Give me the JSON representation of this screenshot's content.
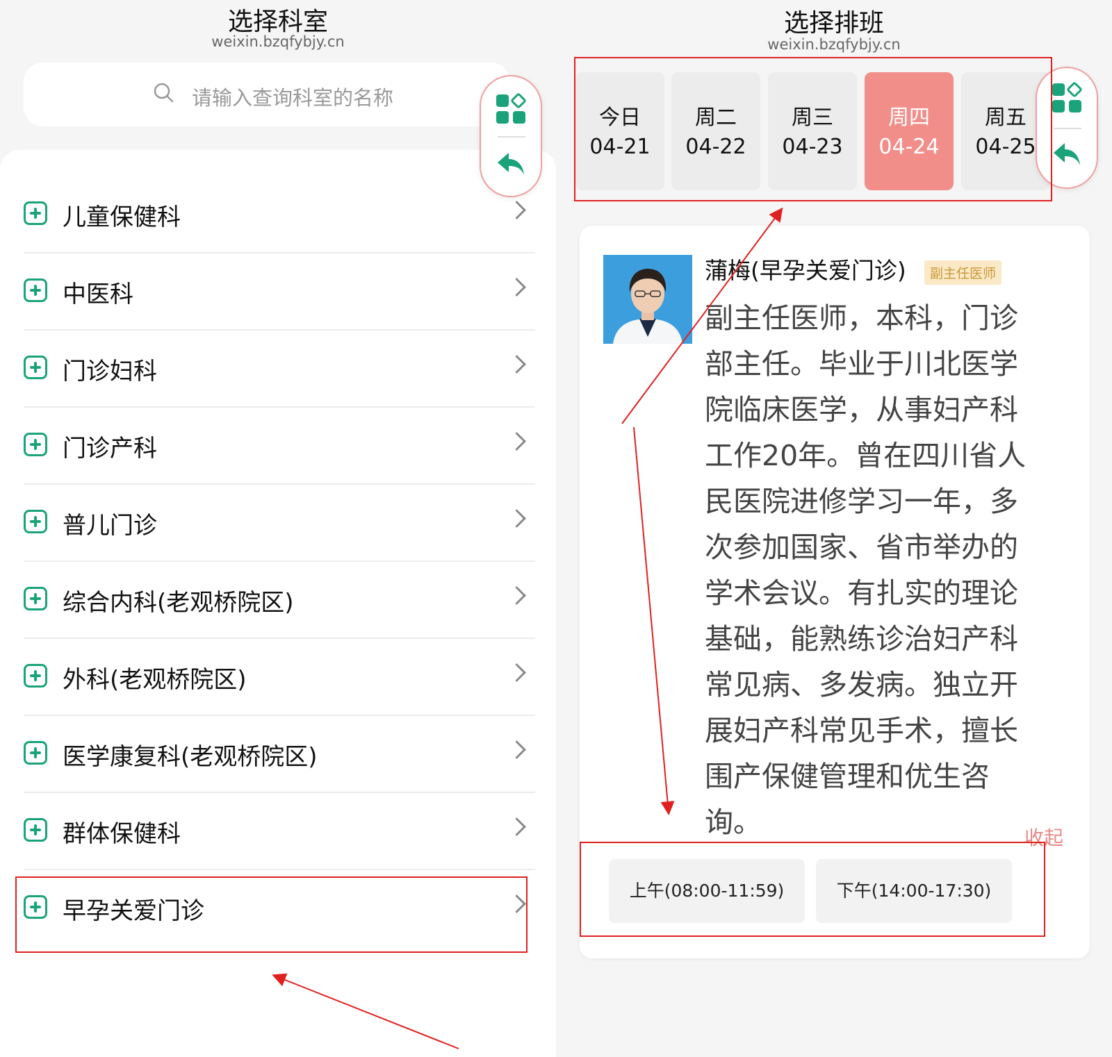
{
  "left": {
    "title": "选择科室",
    "url": "weixin.bzqfybjy.cn",
    "search_placeholder": "请输入查询科室的名称",
    "departments": [
      "儿童保健科",
      "中医科",
      "门诊妇科",
      "门诊产科",
      "普儿门诊",
      "综合内科(老观桥院区)",
      "外科(老观桥院区)",
      "医学康复科(老观桥院区)",
      "群体保健科",
      "早孕关爱门诊"
    ]
  },
  "right": {
    "title": "选择排班",
    "url": "weixin.bzqfybjy.cn",
    "days": [
      {
        "weekday": "今日",
        "date": "04-21",
        "selected": false
      },
      {
        "weekday": "周二",
        "date": "04-22",
        "selected": false
      },
      {
        "weekday": "周三",
        "date": "04-23",
        "selected": false
      },
      {
        "weekday": "周四",
        "date": "04-24",
        "selected": true
      },
      {
        "weekday": "周五",
        "date": "04-25",
        "selected": false
      }
    ],
    "doctor": {
      "name": "蒲梅(早孕关爱门诊)",
      "title_badge": "副主任医师",
      "bio": "副主任医师，本科，门诊部主任。毕业于川北医学院临床医学，从事妇产科工作20年。曾在四川省人民医院进修学习一年，多次参加国家、省市举办的学术会议。有扎实的理论基础，能熟练诊治妇产科常见病、多发病。独立开展妇产科常见手术，擅长围产保健管理和优生咨询。",
      "collapse_label": "收起"
    },
    "slots": [
      "上午(08:00-11:59)",
      "下午(14:00-17:30)"
    ]
  },
  "colors": {
    "accent_green": "#1aa37a",
    "selected_day": "#f28e8a",
    "annotation_red": "#e02020"
  }
}
